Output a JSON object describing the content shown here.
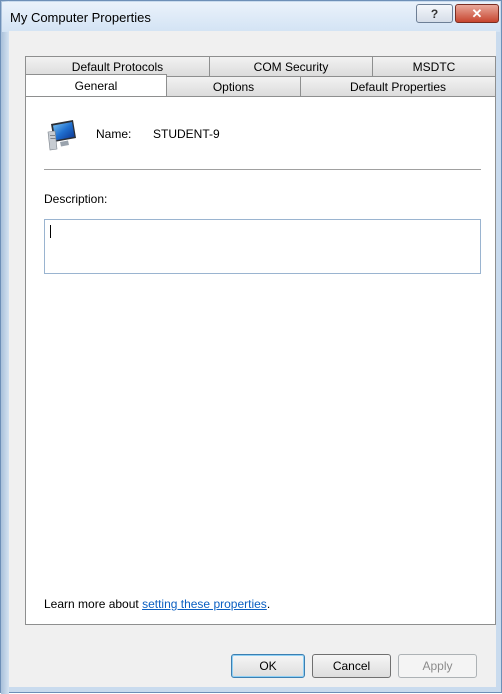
{
  "window": {
    "title": "My Computer Properties",
    "help_icon": "question-mark-icon",
    "close_icon": "close-x-icon"
  },
  "tabs": {
    "back_row": [
      "Default Protocols",
      "COM Security",
      "MSDTC"
    ],
    "front_row": [
      "General",
      "Options",
      "Default Properties"
    ],
    "active": "General"
  },
  "general": {
    "computer_icon": "computer-monitor-icon",
    "name_label": "Name:",
    "name_value": "STUDENT-9",
    "description_label": "Description:",
    "description_value": "",
    "learn_prefix": "Learn more about ",
    "learn_link": "setting these properties",
    "learn_suffix": "."
  },
  "buttons": {
    "ok": "OK",
    "cancel": "Cancel",
    "apply": "Apply"
  },
  "colors": {
    "link": "#0b5fc1",
    "close_button": "#c7452f",
    "input_border": "#9ab4d0"
  }
}
